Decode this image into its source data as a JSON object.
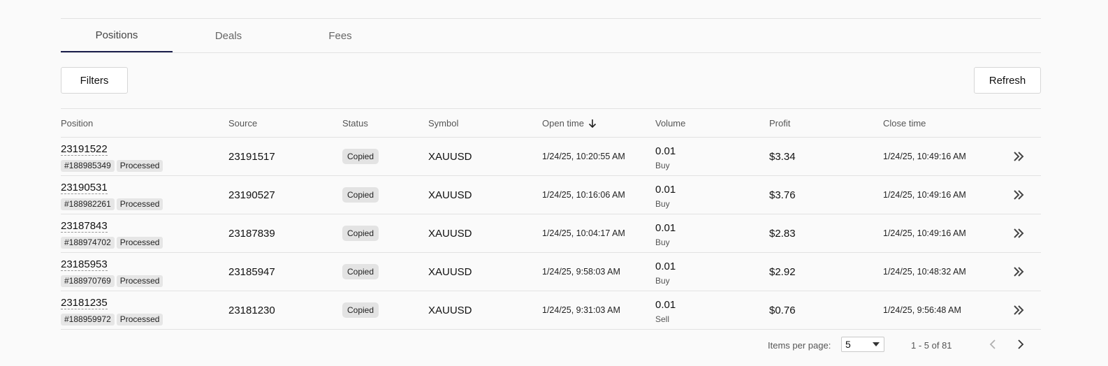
{
  "tabs": [
    {
      "label": "Positions",
      "active": true
    },
    {
      "label": "Deals",
      "active": false
    },
    {
      "label": "Fees",
      "active": false
    }
  ],
  "toolbar": {
    "filters_label": "Filters",
    "refresh_label": "Refresh"
  },
  "table": {
    "headers": {
      "position": "Position",
      "source": "Source",
      "status": "Status",
      "symbol": "Symbol",
      "open_time": "Open time",
      "volume": "Volume",
      "profit": "Profit",
      "close_time": "Close time"
    },
    "sort_icon": "arrow-down-icon",
    "rows": [
      {
        "position": "23191522",
        "deal": "#188985349",
        "state": "Processed",
        "source": "23191517",
        "status": "Copied",
        "symbol": "XAUUSD",
        "open_time": "1/24/25, 10:20:55 AM",
        "volume": "0.01",
        "side": "Buy",
        "profit": "$3.34",
        "close_time": "1/24/25, 10:49:16 AM"
      },
      {
        "position": "23190531",
        "deal": "#188982261",
        "state": "Processed",
        "source": "23190527",
        "status": "Copied",
        "symbol": "XAUUSD",
        "open_time": "1/24/25, 10:16:06 AM",
        "volume": "0.01",
        "side": "Buy",
        "profit": "$3.76",
        "close_time": "1/24/25, 10:49:16 AM"
      },
      {
        "position": "23187843",
        "deal": "#188974702",
        "state": "Processed",
        "source": "23187839",
        "status": "Copied",
        "symbol": "XAUUSD",
        "open_time": "1/24/25, 10:04:17 AM",
        "volume": "0.01",
        "side": "Buy",
        "profit": "$2.83",
        "close_time": "1/24/25, 10:49:16 AM"
      },
      {
        "position": "23185953",
        "deal": "#188970769",
        "state": "Processed",
        "source": "23185947",
        "status": "Copied",
        "symbol": "XAUUSD",
        "open_time": "1/24/25, 9:58:03 AM",
        "volume": "0.01",
        "side": "Buy",
        "profit": "$2.92",
        "close_time": "1/24/25, 10:48:32 AM"
      },
      {
        "position": "23181235",
        "deal": "#188959972",
        "state": "Processed",
        "source": "23181230",
        "status": "Copied",
        "symbol": "XAUUSD",
        "open_time": "1/24/25, 9:31:03 AM",
        "volume": "0.01",
        "side": "Sell",
        "profit": "$0.76",
        "close_time": "1/24/25, 9:56:48 AM"
      }
    ]
  },
  "pagination": {
    "items_per_page_label": "Items per page:",
    "items_per_page_value": "5",
    "range_text": "1 - 5 of 81"
  },
  "colors": {
    "active_tab_underline": "#1b1f4b"
  }
}
